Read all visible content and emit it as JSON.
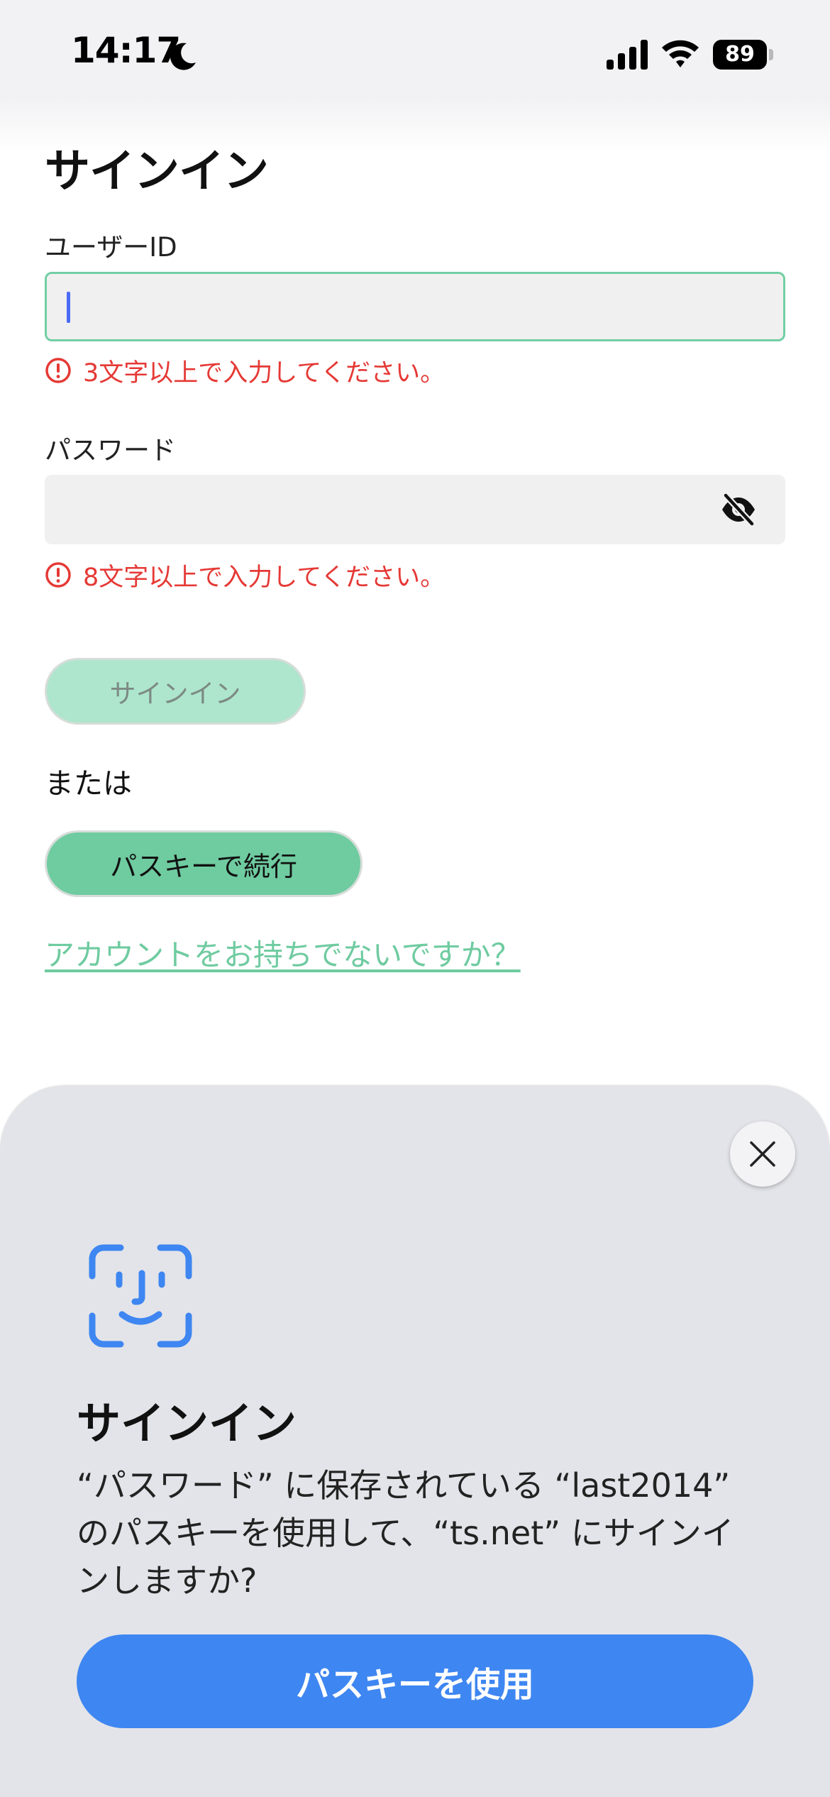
{
  "status_bar": {
    "time": "14:17",
    "battery_level": "89",
    "icons": [
      "moon-icon",
      "signal-icon",
      "wifi-icon",
      "battery-icon"
    ]
  },
  "form": {
    "title": "サインイン",
    "userid": {
      "label": "ユーザーID",
      "value": "",
      "error": "3文字以上で入力してください。"
    },
    "password": {
      "label": "パスワード",
      "value": "",
      "error": "8文字以上で入力してください。"
    },
    "signin_button": "サインイン",
    "or_text": "または",
    "passkey_button": "パスキーで続行",
    "signup_link": "アカウントをお持ちでないですか？"
  },
  "passkey_sheet": {
    "title": "サインイン",
    "message": "“パスワード” に保存されている “last2014” のパスキーを使用して、“ts.net” にサインインしますか?",
    "use_button": "パスキーを使用"
  },
  "colors": {
    "accent_green": "#6fcba0",
    "focus_border": "#72cfa4",
    "error_red": "#e53935",
    "sheet_blue": "#3e86f1",
    "sheet_background": "#e3e4e9"
  }
}
